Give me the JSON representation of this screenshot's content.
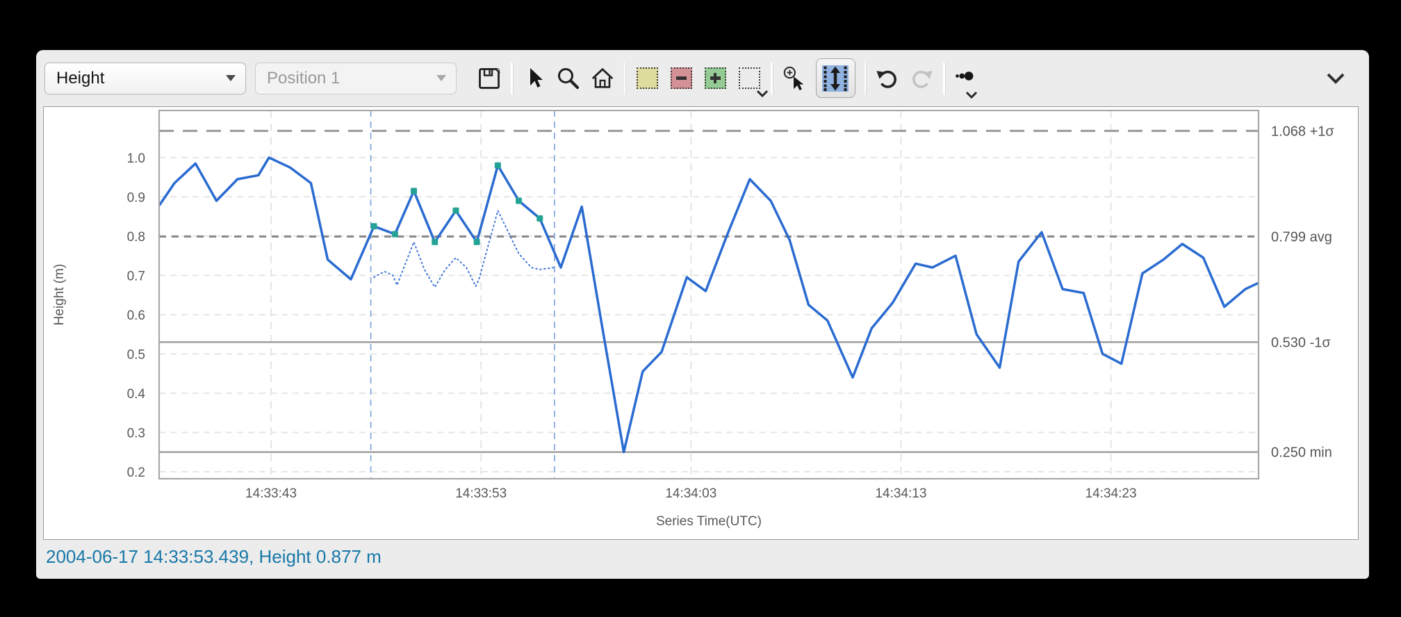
{
  "window": {
    "toolbar": {
      "series_selector": {
        "value": "Height",
        "disabled": false
      },
      "position_selector": {
        "value": "Position 1",
        "disabled": true
      },
      "icons": [
        {
          "name": "save-icon"
        },
        {
          "name": "cursor-arrow-icon"
        },
        {
          "name": "zoom-magnifier-icon"
        },
        {
          "name": "home-icon"
        },
        {
          "name": "select-region-icon",
          "color": "#dedc9e"
        },
        {
          "name": "subtract-region-icon",
          "color": "#d59296",
          "glyph": "minus"
        },
        {
          "name": "add-region-icon",
          "color": "#95cb95",
          "glyph": "plus"
        },
        {
          "name": "select-box-menu-icon"
        },
        {
          "name": "zoom-in-cursor-icon"
        },
        {
          "name": "y-axis-zoom-icon",
          "active": true,
          "active_bg": "#8fb2e0"
        },
        {
          "name": "undo-icon",
          "enabled": true
        },
        {
          "name": "redo-icon",
          "enabled": false
        },
        {
          "name": "point-size-menu-icon"
        },
        {
          "name": "collapse-chevron-icon"
        }
      ]
    },
    "status": {
      "text": "2004-06-17 14:33:53.439, Height 0.877 m",
      "color": "#1878a8"
    }
  },
  "chart_data": {
    "type": "line",
    "title": "",
    "xlabel": "Series Time(UTC)",
    "ylabel": "Height (m)",
    "x_unit": "seconds past 2004-06-17 14:33:00 UTC",
    "x_range": [
      37.67,
      90.03
    ],
    "y_range": [
      0.182,
      1.12
    ],
    "grid": true,
    "x_ticks": [
      {
        "t": 43,
        "label": "14:33:43"
      },
      {
        "t": 53,
        "label": "14:33:53"
      },
      {
        "t": 63,
        "label": "14:34:03"
      },
      {
        "t": 73,
        "label": "14:34:13"
      },
      {
        "t": 83,
        "label": "14:34:23"
      }
    ],
    "y_ticks": [
      0.2,
      0.3,
      0.4,
      0.5,
      0.6,
      0.7,
      0.8,
      0.9,
      1.0
    ],
    "series": [
      {
        "name": "Height",
        "color": "#2a6bd1",
        "width": 3.5,
        "style": "solid",
        "points": [
          [
            37.7,
            0.88
          ],
          [
            38.4,
            0.935
          ],
          [
            39.4,
            0.985
          ],
          [
            40.4,
            0.89
          ],
          [
            41.4,
            0.945
          ],
          [
            42.4,
            0.955
          ],
          [
            42.9,
            1.0
          ],
          [
            43.9,
            0.975
          ],
          [
            44.9,
            0.935
          ],
          [
            45.7,
            0.74
          ],
          [
            46.8,
            0.69
          ],
          [
            47.9,
            0.825
          ],
          [
            48.9,
            0.805
          ],
          [
            49.8,
            0.915
          ],
          [
            50.8,
            0.785
          ],
          [
            51.8,
            0.865
          ],
          [
            52.8,
            0.785
          ],
          [
            53.8,
            0.98
          ],
          [
            54.8,
            0.89
          ],
          [
            55.8,
            0.845
          ],
          [
            56.8,
            0.72
          ],
          [
            57.8,
            0.875
          ],
          [
            58.8,
            0.56
          ],
          [
            59.8,
            0.25
          ],
          [
            60.7,
            0.455
          ],
          [
            61.6,
            0.505
          ],
          [
            62.8,
            0.695
          ],
          [
            63.7,
            0.66
          ],
          [
            64.7,
            0.8
          ],
          [
            65.8,
            0.945
          ],
          [
            66.8,
            0.89
          ],
          [
            67.7,
            0.79
          ],
          [
            68.6,
            0.625
          ],
          [
            69.5,
            0.585
          ],
          [
            70.7,
            0.44
          ],
          [
            71.6,
            0.565
          ],
          [
            72.6,
            0.63
          ],
          [
            73.7,
            0.73
          ],
          [
            74.5,
            0.72
          ],
          [
            75.6,
            0.75
          ],
          [
            76.6,
            0.55
          ],
          [
            77.7,
            0.465
          ],
          [
            78.6,
            0.735
          ],
          [
            79.7,
            0.81
          ],
          [
            80.7,
            0.665
          ],
          [
            81.7,
            0.655
          ],
          [
            82.6,
            0.5
          ],
          [
            83.5,
            0.475
          ],
          [
            84.5,
            0.705
          ],
          [
            85.5,
            0.74
          ],
          [
            86.4,
            0.78
          ],
          [
            87.4,
            0.745
          ],
          [
            88.4,
            0.62
          ],
          [
            89.4,
            0.665
          ],
          [
            90.0,
            0.68
          ]
        ]
      },
      {
        "name": "Height-filtered",
        "color": "#3f76d6",
        "width": 2,
        "style": "dotted",
        "points": [
          [
            47.9,
            0.695
          ],
          [
            48.4,
            0.71
          ],
          [
            48.8,
            0.7
          ],
          [
            49.0,
            0.675
          ],
          [
            49.8,
            0.785
          ],
          [
            50.3,
            0.715
          ],
          [
            50.8,
            0.67
          ],
          [
            51.3,
            0.715
          ],
          [
            51.8,
            0.745
          ],
          [
            52.3,
            0.72
          ],
          [
            52.75,
            0.672
          ],
          [
            52.9,
            0.69
          ],
          [
            53.8,
            0.865
          ],
          [
            54.3,
            0.81
          ],
          [
            54.8,
            0.755
          ],
          [
            55.4,
            0.72
          ],
          [
            55.8,
            0.715
          ],
          [
            56.5,
            0.72
          ]
        ]
      }
    ],
    "selected_markers": {
      "color": "#23a295",
      "points": [
        [
          47.9,
          0.825
        ],
        [
          48.9,
          0.805
        ],
        [
          49.8,
          0.915
        ],
        [
          50.8,
          0.785
        ],
        [
          51.8,
          0.865
        ],
        [
          52.8,
          0.785
        ],
        [
          53.8,
          0.98
        ],
        [
          54.8,
          0.89
        ],
        [
          55.8,
          0.845
        ]
      ]
    },
    "selection_region": {
      "t_start": 47.75,
      "t_end": 56.5,
      "color": "#7aa0dc"
    },
    "reference_lines": [
      {
        "value": 1.068,
        "label": "1.068 +1σ",
        "style": "longdash",
        "color": "#999999",
        "width": 3
      },
      {
        "value": 0.799,
        "label": "0.799 avg",
        "style": "dash",
        "color": "#878787",
        "width": 3
      },
      {
        "value": 0.53,
        "label": "0.530 -1σ",
        "style": "solid",
        "color": "#9f9f9f",
        "width": 2.5
      },
      {
        "value": 0.25,
        "label": "0.250 min",
        "style": "solid",
        "color": "#9f9f9f",
        "width": 2.5
      }
    ],
    "legend": "none",
    "colors": {
      "grid": "#e5e5e5",
      "frame": "#a8a8a8",
      "tick_text": "#58585a",
      "annotation_text": "#555555"
    }
  }
}
